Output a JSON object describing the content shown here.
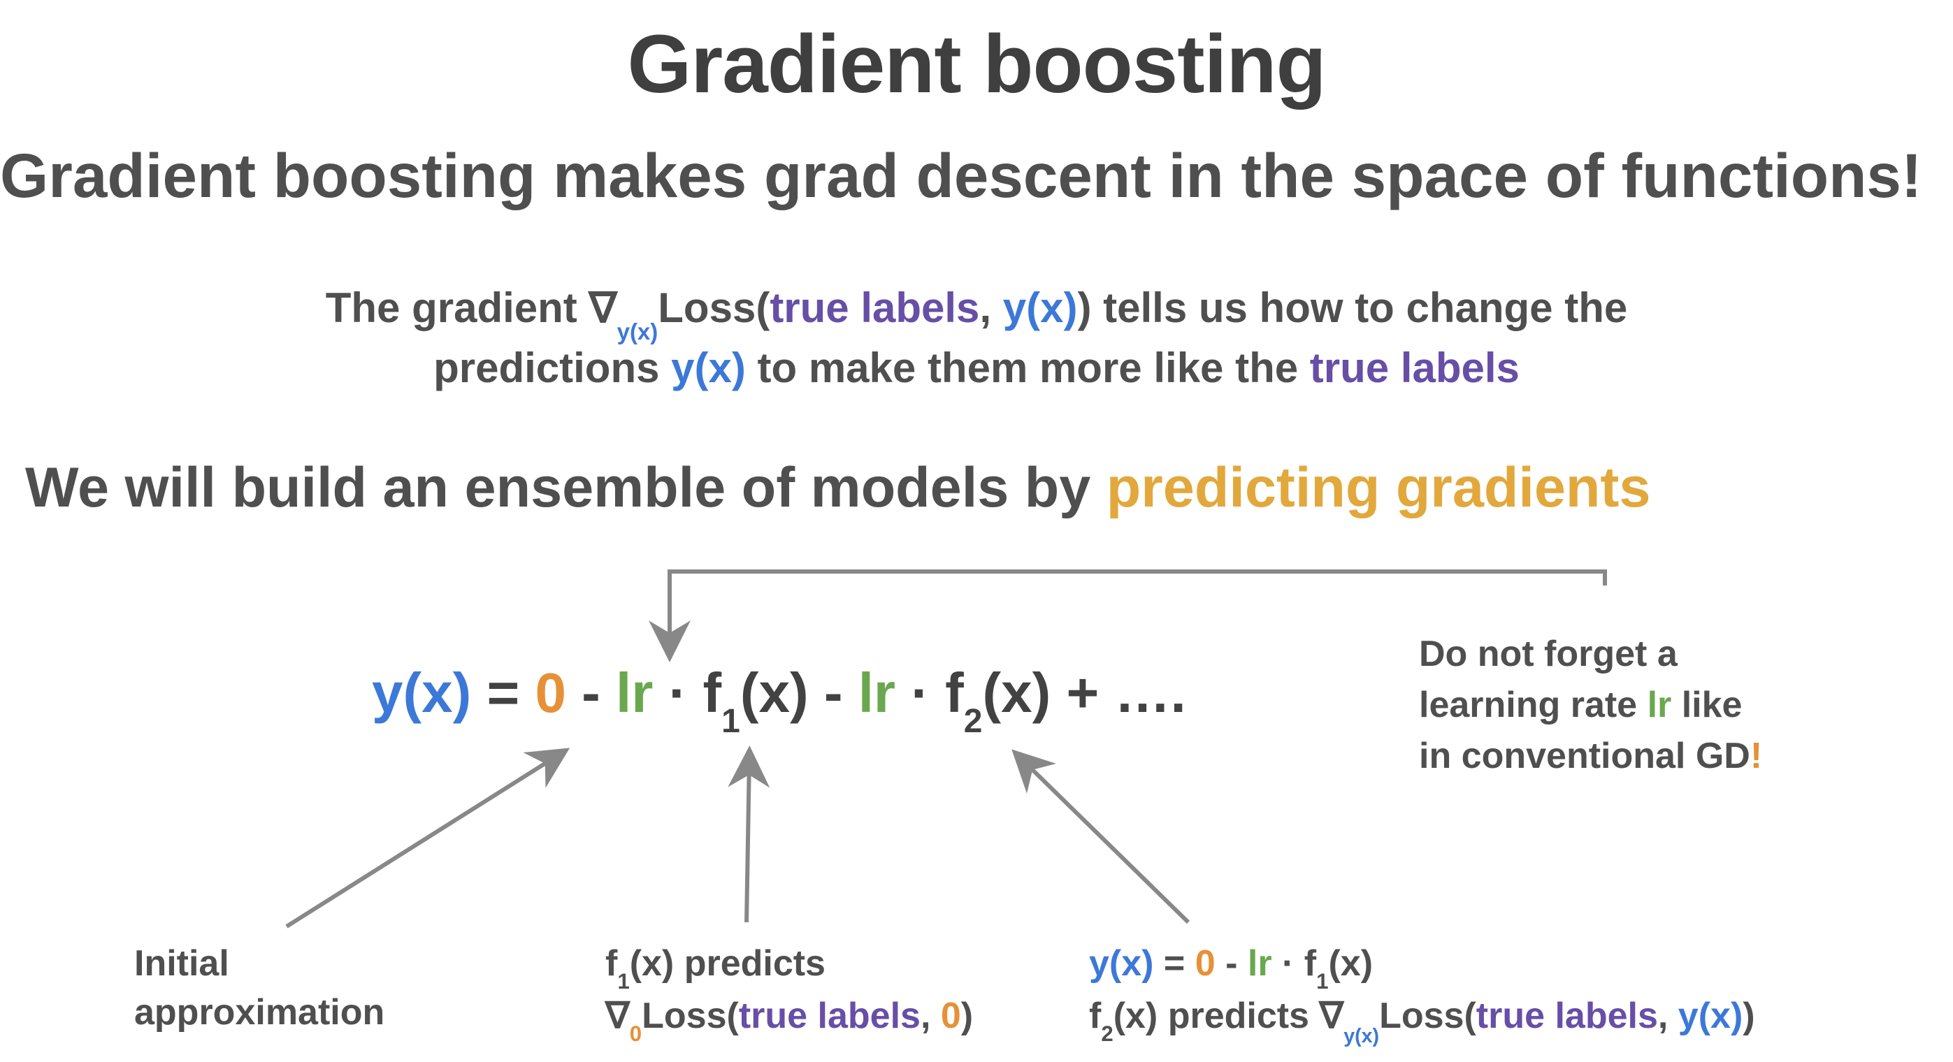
{
  "title": "Gradient boosting",
  "subtitle": "Gradient boosting makes grad descent in the space of functions!",
  "explain": {
    "p1a": "The gradient ∇",
    "p1sub": "y(x)",
    "p1b": "Loss(",
    "p1true": "true labels",
    "p1comma": ", ",
    "p1yx": "y(x)",
    "p1c": ") tells us how to change the",
    "p2a": "predictions ",
    "p2yx": "y(x)",
    "p2b": " to make them more like the ",
    "p2true": "true labels"
  },
  "ensemble": {
    "a": "We will build an ensemble of models by ",
    "gold": "predicting gradients"
  },
  "formula": {
    "yx": "y(x)",
    "eq": " = ",
    "zero": "0",
    "minus1": " - ",
    "lr1": "lr",
    "dot1": " · f",
    "sub1": "1",
    "after1": "(x) - ",
    "lr2": "lr",
    "dot2": " · f",
    "sub2": "2",
    "after2": "(x) + …."
  },
  "note_right": {
    "l1": "Do not forget a",
    "l2a": "learning rate ",
    "l2lr": "lr",
    "l2b": " like",
    "l3a": "in conventional GD",
    "l3ex": "!"
  },
  "note_initial": {
    "l1": "Initial",
    "l2": "approximation"
  },
  "note_f1": {
    "l1a": "f",
    "l1sub": "1",
    "l1b": "(x) predicts",
    "l2a": "∇",
    "l2sub": "0",
    "l2b": "Loss(",
    "l2true": "true labels",
    "l2comma": ", ",
    "l2zero": "0",
    "l2close": ")"
  },
  "note_f2": {
    "l1a_yx": "y(x)",
    "l1_eq": " = ",
    "l1_zero": "0",
    "l1_minus": " - ",
    "l1_lr": "lr",
    "l1_dot": " · f",
    "l1_sub": "1",
    "l1_after": "(x)",
    "l2a": "f",
    "l2sub": "2",
    "l2b": "(x) predicts ∇",
    "l2subx": "y(x)",
    "l2c": "Loss(",
    "l2true": "true labels",
    "l2comma": ", ",
    "l2yx": "y(x)",
    "l2close": ")"
  }
}
